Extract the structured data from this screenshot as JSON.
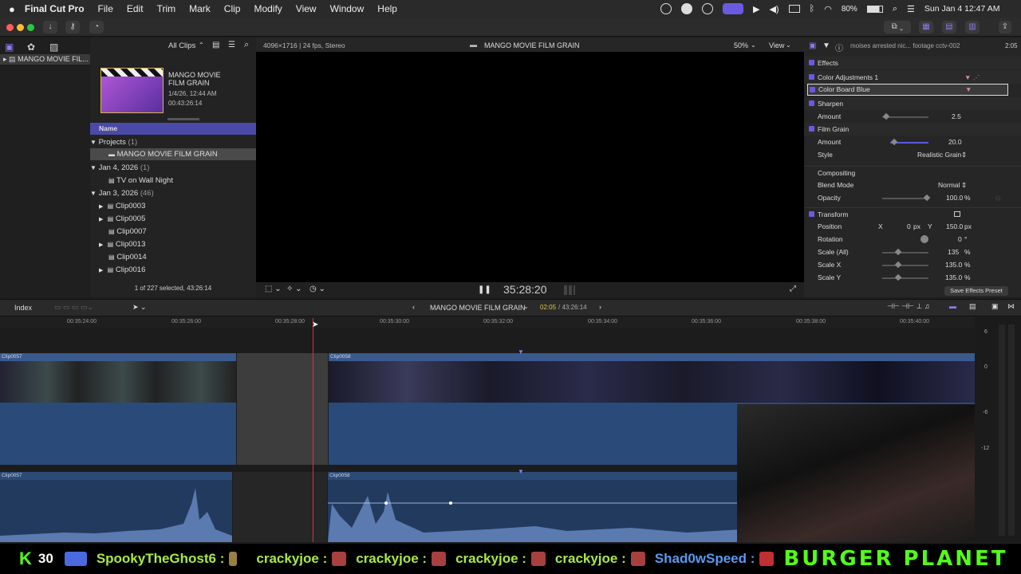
{
  "menubar": {
    "app": "Final Cut Pro",
    "items": [
      "File",
      "Edit",
      "Trim",
      "Mark",
      "Clip",
      "Modify",
      "View",
      "Window",
      "Help"
    ],
    "battery": "80%",
    "clock": "Sun Jan 4  12:47 AM"
  },
  "browser": {
    "filter": "All Clips",
    "library": "MANGO MOVIE FIL...",
    "project_title": "MANGO MOVIE FILM GRAIN",
    "project_date": "1/4/26, 12:44 AM",
    "project_duration": "00:43:26:14",
    "column_header": "Name",
    "groups": [
      {
        "label": "Projects",
        "count": "(1)",
        "items": [
          {
            "name": "MANGO MOVIE FILM GRAIN",
            "selected": true
          }
        ]
      },
      {
        "label": "Jan 4, 2026",
        "count": "(1)",
        "items": [
          {
            "name": "TV on Wall Night"
          }
        ]
      },
      {
        "label": "Jan 3, 2026",
        "count": "(46)",
        "items": [
          {
            "name": "Clip0003",
            "expand": true
          },
          {
            "name": "Clip0005",
            "expand": true
          },
          {
            "name": "Clip0007",
            "expand": false
          },
          {
            "name": "Clip0013",
            "expand": true
          },
          {
            "name": "Clip0014",
            "expand": false
          },
          {
            "name": "Clip0016",
            "expand": true
          }
        ]
      }
    ],
    "status": "1 of 227 selected, 43:26:14"
  },
  "viewer": {
    "format": "4096×1716 | 24 fps, Stereo",
    "title": "MANGO MOVIE FILM GRAIN",
    "zoom": "50%",
    "view_menu": "View",
    "timecode": "35:28:20"
  },
  "inspector": {
    "clip_name": "moises arrested nic... footage cctv-002",
    "clip_time": "2:05",
    "effects_header": "Effects",
    "color_adjustments": "Color Adjustments 1",
    "color_board": "Color Board Blue",
    "sharpen": "Sharpen",
    "sharpen_amount_label": "Amount",
    "sharpen_amount": "2.5",
    "film_grain": "Film Grain",
    "grain_amount_label": "Amount",
    "grain_amount": "20.0",
    "style_label": "Style",
    "style_value": "Realistic Grain",
    "compositing": "Compositing",
    "blend_label": "Blend Mode",
    "blend_value": "Normal",
    "opacity_label": "Opacity",
    "opacity_value": "100.0",
    "opacity_unit": "%",
    "transform": "Transform",
    "position_label": "Position",
    "pos_x_label": "X",
    "pos_x": "0",
    "pos_unit": "px",
    "pos_y_label": "Y",
    "pos_y": "150.0",
    "rotation_label": "Rotation",
    "rotation_value": "0",
    "rotation_unit": "°",
    "scale_all_label": "Scale (All)",
    "scale_all": "135",
    "scale_x_label": "Scale X",
    "scale_x": "135.0",
    "scale_y_label": "Scale Y",
    "scale_y": "135.0",
    "save_preset": "Save Effects Preset"
  },
  "timeline_bar": {
    "index": "Index",
    "project": "MANGO MOVIE FILM GRAIN",
    "position": "02:05",
    "duration": "/ 43:26:14"
  },
  "ruler": [
    "00:35:24:00",
    "00:35:26:00",
    "00:35:28:00",
    "00:35:30:00",
    "00:35:32:00",
    "00:35:34:00",
    "00:35:36:00",
    "00:35:38:00",
    "00:35:40:00"
  ],
  "clips": {
    "clip_a": "Clip0057",
    "clip_b": "Clip0058",
    "audio_a": "Clip0057",
    "audio_b": "Clip0058"
  },
  "meter_labels": [
    "6",
    "0",
    "-6",
    "-12"
  ],
  "ticker": {
    "count": "30",
    "names": [
      "SpookyTheGhost6 :",
      "crackyjoe :",
      "crackyjoe :",
      "crackyjoe :",
      "crackyjoe :",
      "Shad0wSpeed :"
    ],
    "banner": "BURGER PLANET"
  }
}
